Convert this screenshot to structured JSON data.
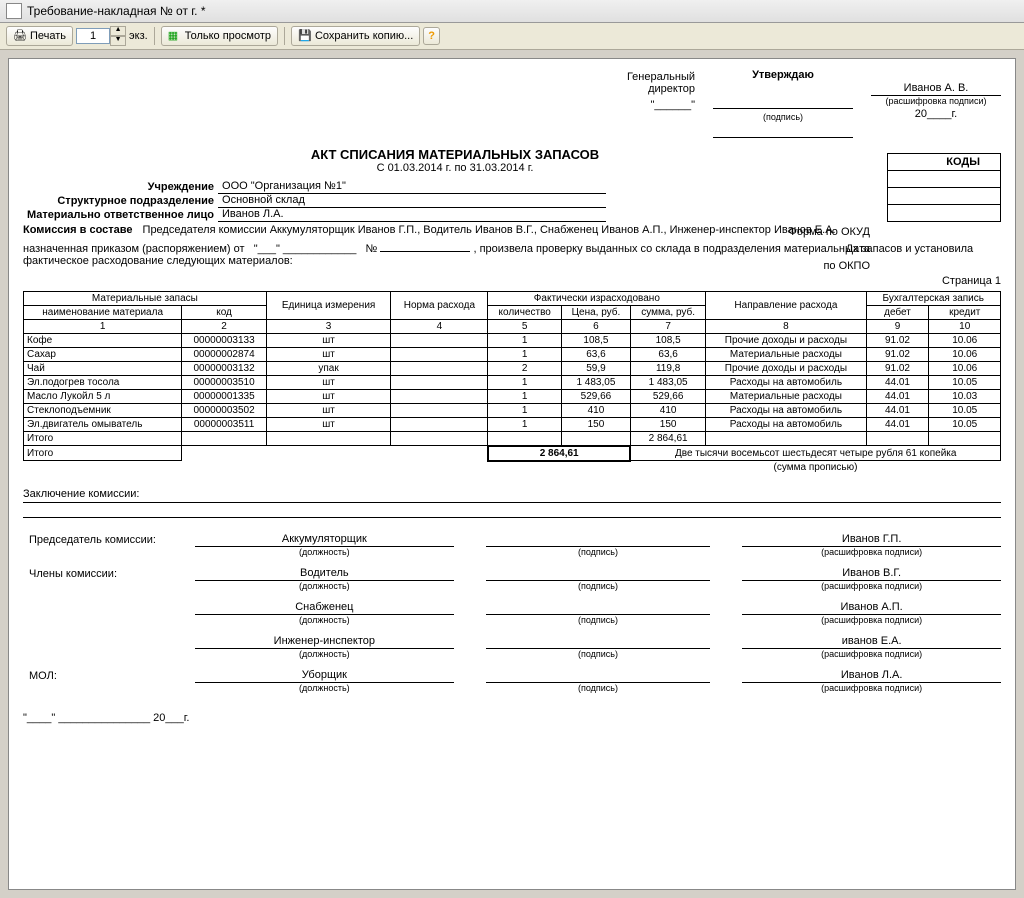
{
  "window": {
    "title": "Требование-накладная №   от   г.  *"
  },
  "toolbar": {
    "print": "Печать",
    "copies": "1",
    "copies_lbl": "экз.",
    "view_only": "Только просмотр",
    "save_copy": "Сохранить копию..."
  },
  "approve": {
    "title": "Утверждаю",
    "dir_lbl1": "Генеральный",
    "dir_lbl2": "директор",
    "podpis": "(подпись)",
    "name": "Иванов А. В.",
    "rasshifr": "(расшифровка подписи)",
    "year_prefix": "20____г.",
    "date_lbl": "Дата",
    "kody": "КОДЫ",
    "okud": "Форма по ОКУД",
    "okpo": "по ОКПО"
  },
  "header": {
    "title": "АКТ СПИСАНИЯ МАТЕРИАЛЬНЫХ ЗАПАСОВ",
    "period": "С 01.03.2014 г. по 31.03.2014 г."
  },
  "meta": {
    "uchr_lbl": "Учреждение",
    "uchr": "ООО \"Организация №1\"",
    "podr_lbl": "Структурное подразделение",
    "podr": "Основной склад",
    "mol_lbl": "Материально ответственное лицо",
    "mol": "Иванов Л.А.",
    "komis_lbl": "Комиссия в составе",
    "komis": "Председателя комиссии Аккумуляторщик Иванов Г.П., Водитель Иванов В.Г., Снабженец Иванов А.П., Инженер-инспектор Иванов Е.А.",
    "naznach_lbl": "назначенная приказом (распоряжением) от",
    "naznach_mid": "№",
    "naznach_tail": ", произвела проверку выданных со склада в подразделения материальных запасов и установила фактическое расходование следующих материалов:",
    "page": "Страница 1"
  },
  "columns": {
    "matzap": "Материальные запасы",
    "ed": "Единица измерения",
    "norma": "Норма расхода",
    "fact": "Фактически израсходовано",
    "napravl": "Направление расхода",
    "buh": "Бухгалтерская запись",
    "naim": "наименование материала",
    "kod": "код",
    "kolvo": "количество",
    "cena": "Цена, руб.",
    "summa": "сумма, руб.",
    "debet": "дебет",
    "kredit": "кредит"
  },
  "rows": [
    {
      "n": "Кофе",
      "k": "00000003133",
      "e": "шт",
      "norm": "",
      "q": "1",
      "p": "108,5",
      "s": "108,5",
      "dir": "Прочие доходы и расходы",
      "d": "91.02",
      "c": "10.06"
    },
    {
      "n": "Сахар",
      "k": "00000002874",
      "e": "шт",
      "norm": "",
      "q": "1",
      "p": "63,6",
      "s": "63,6",
      "dir": "Материальные расходы",
      "d": "91.02",
      "c": "10.06"
    },
    {
      "n": "Чай",
      "k": "00000003132",
      "e": "упак",
      "norm": "",
      "q": "2",
      "p": "59,9",
      "s": "119,8",
      "dir": "Прочие доходы и расходы",
      "d": "91.02",
      "c": "10.06"
    },
    {
      "n": "Эл.подогрев тосола",
      "k": "00000003510",
      "e": "шт",
      "norm": "",
      "q": "1",
      "p": "1 483,05",
      "s": "1 483,05",
      "dir": "Расходы на автомобиль",
      "d": "44.01",
      "c": "10.05"
    },
    {
      "n": "Масло Лукойл 5 л",
      "k": "00000001335",
      "e": "шт",
      "norm": "",
      "q": "1",
      "p": "529,66",
      "s": "529,66",
      "dir": "Материальные расходы",
      "d": "44.01",
      "c": "10.03"
    },
    {
      "n": "Стеклоподъемник",
      "k": "00000003502",
      "e": "шт",
      "norm": "",
      "q": "1",
      "p": "410",
      "s": "410",
      "dir": "Расходы на автомобиль",
      "d": "44.01",
      "c": "10.05"
    },
    {
      "n": "Эл.двигатель омыватель",
      "k": "00000003511",
      "e": "шт",
      "norm": "",
      "q": "1",
      "p": "150",
      "s": "150",
      "dir": "Расходы на автомобиль",
      "d": "44.01",
      "c": "10.05"
    }
  ],
  "totals": {
    "itogo": "Итого",
    "sum1": "2 864,61",
    "sum2": "2 864,61",
    "words": "Две тысячи восемьсот шестьдесят четыре рубля 61 копейка",
    "words_lbl": "(сумма прописью)"
  },
  "concl": {
    "lbl": "Заключение комиссии:"
  },
  "signatures": {
    "pred_lbl": "Председатель комиссии:",
    "chlen_lbl": "Члены комиссии:",
    "mol_lbl": "МОЛ:",
    "dolzhn": "(должность)",
    "podpis": "(подпись)",
    "rasshifr": "(расшифровка подписи)",
    "rows": [
      {
        "pos": "Аккумуляторщик",
        "name": "Иванов Г.П."
      },
      {
        "pos": "Водитель",
        "name": "Иванов В.Г."
      },
      {
        "pos": "Снабженец",
        "name": "Иванов А.П."
      },
      {
        "pos": "Инженер-инспектор",
        "name": "иванов Е.А."
      },
      {
        "pos": "Уборщик",
        "name": "Иванов Л.А."
      }
    ],
    "date_tail": "20___г."
  },
  "chart_data": {
    "type": "table",
    "title": "АКТ СПИСАНИЯ МАТЕРИАЛЬНЫХ ЗАПАСОВ С 01.03.2014 г. по 31.03.2014 г.",
    "columns": [
      "наименование материала",
      "код",
      "Единица измерения",
      "Норма расхода",
      "количество",
      "Цена, руб.",
      "сумма, руб.",
      "Направление расхода",
      "дебет",
      "кредит"
    ],
    "rows": [
      [
        "Кофе",
        "00000003133",
        "шт",
        "",
        1,
        108.5,
        108.5,
        "Прочие доходы и расходы",
        "91.02",
        "10.06"
      ],
      [
        "Сахар",
        "00000002874",
        "шт",
        "",
        1,
        63.6,
        63.6,
        "Материальные расходы",
        "91.02",
        "10.06"
      ],
      [
        "Чай",
        "00000003132",
        "упак",
        "",
        2,
        59.9,
        119.8,
        "Прочие доходы и расходы",
        "91.02",
        "10.06"
      ],
      [
        "Эл.подогрев тосола",
        "00000003510",
        "шт",
        "",
        1,
        1483.05,
        1483.05,
        "Расходы на автомобиль",
        "44.01",
        "10.05"
      ],
      [
        "Масло Лукойл 5 л",
        "00000001335",
        "шт",
        "",
        1,
        529.66,
        529.66,
        "Материальные расходы",
        "44.01",
        "10.03"
      ],
      [
        "Стеклоподъемник",
        "00000003502",
        "шт",
        "",
        1,
        410,
        410,
        "Расходы на автомобиль",
        "44.01",
        "10.05"
      ],
      [
        "Эл.двигатель омыватель",
        "00000003511",
        "шт",
        "",
        1,
        150,
        150,
        "Расходы на автомобиль",
        "44.01",
        "10.05"
      ]
    ],
    "total_sum": 2864.61
  }
}
